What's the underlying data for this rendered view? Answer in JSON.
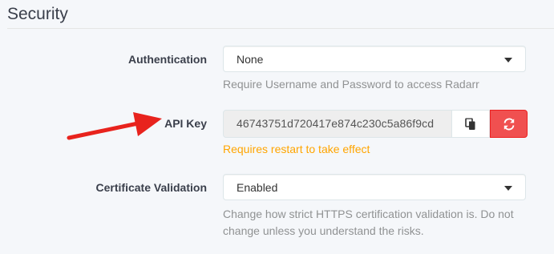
{
  "section": {
    "title": "Security"
  },
  "fields": {
    "authentication": {
      "label": "Authentication",
      "value": "None",
      "help": "Require Username and Password to access Radarr"
    },
    "api_key": {
      "label": "API Key",
      "value": "46743751d720417e874c230c5a86f9cd",
      "warning": "Requires restart to take effect"
    },
    "certificate_validation": {
      "label": "Certificate Validation",
      "value": "Enabled",
      "help_line1": "Change how strict HTTPS certification validation is. Do not",
      "help_line2": "change unless you understand the risks."
    }
  },
  "icons": {
    "copy": "clipboard-icon",
    "regenerate": "refresh-icon",
    "caret": "caret-down-icon"
  },
  "colors": {
    "danger": "#f05050",
    "warning": "#ffa500",
    "annotation_arrow": "#e8231d"
  }
}
